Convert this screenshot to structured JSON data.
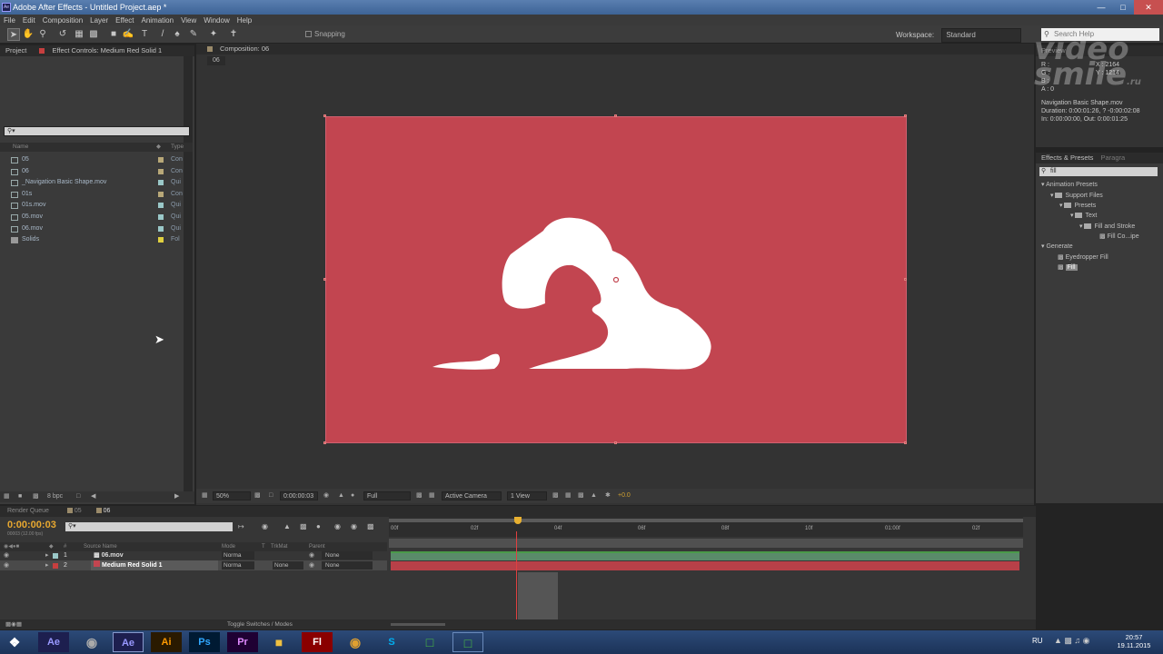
{
  "window": {
    "title": "Adobe After Effects - Untitled Project.aep *"
  },
  "menu": [
    "File",
    "Edit",
    "Composition",
    "Layer",
    "Effect",
    "Animation",
    "View",
    "Window",
    "Help"
  ],
  "toolbar": {
    "snapping": "Snapping",
    "workspace_label": "Workspace:",
    "workspace_value": "Standard",
    "search_placeholder": "Search Help"
  },
  "project_panel": {
    "tab_project": "Project",
    "tab_effect_controls": "Effect Controls: Medium Red Solid 1",
    "col_name": "Name",
    "col_type": "Type",
    "items": [
      {
        "name": "05",
        "type": "Con",
        "label_color": "#b8a878"
      },
      {
        "name": "06",
        "type": "Con",
        "label_color": "#b8a878"
      },
      {
        "name": "_Navigation Basic Shape.mov",
        "type": "Qui",
        "label_color": "#9ac8c8"
      },
      {
        "name": "01s",
        "type": "Con",
        "label_color": "#b8a878"
      },
      {
        "name": "01s.mov",
        "type": "Qui",
        "label_color": "#9ac8c8"
      },
      {
        "name": "05.mov",
        "type": "Qui",
        "label_color": "#9ac8c8"
      },
      {
        "name": "06.mov",
        "type": "Qui",
        "label_color": "#9ac8c8"
      },
      {
        "name": "Solids",
        "type": "Fol",
        "label_color": "#e0d040"
      }
    ],
    "bpc": "8 bpc"
  },
  "composition": {
    "tab": "Composition: 06",
    "breadcrumb": "06",
    "solid_color": "#c24550"
  },
  "viewer_controls": {
    "zoom": "50%",
    "timecode": "0:00:00:03",
    "resolution": "Full",
    "camera": "Active Camera",
    "views": "1 View",
    "exposure": "+0.0"
  },
  "info_panel": {
    "lines": [
      "Navigation Basic Shape.mov",
      "Duration: 0:00:01:26, ? -0:00:02:08",
      "In: 0:00:00:00, Out: 0:00:01:25"
    ],
    "r": "R :",
    "g": "G :",
    "b": "B :",
    "a": "A : 0",
    "x": "X : 2164",
    "y": "Y : 1214"
  },
  "effects_presets": {
    "tab_effects": "Effects & Presets",
    "tab_para": "Paragra",
    "search_value": "fill",
    "tree": [
      "Animation Presets",
      "Support Files",
      "Presets",
      "Text",
      "Fill and Stroke",
      "Fill Co...ipe",
      "Generate",
      "Eyedropper Fill",
      "Fill"
    ]
  },
  "timeline": {
    "tab_render": "Render Queue",
    "tab_05": "05",
    "tab_06": "06",
    "timecode": "0:00:00:03",
    "fps": "00003 (12.00 fps)",
    "col_source": "Source Name",
    "col_mode": "Mode",
    "col_t": "T",
    "col_trkmat": "TrkMat",
    "col_parent": "Parent",
    "ticks": [
      "00f",
      "02f",
      "04f",
      "06f",
      "08f",
      "10f",
      "01:00f",
      "02f"
    ],
    "layers": [
      {
        "num": "1",
        "name": "06.mov",
        "mode": "Norma",
        "trkmat": "",
        "parent": "None"
      },
      {
        "num": "2",
        "name": "Medium Red Solid 1",
        "mode": "Norma",
        "trkmat": "None",
        "parent": "None"
      }
    ],
    "toggle": "Toggle Switches / Modes"
  },
  "taskbar": {
    "lang": "RU",
    "time": "20:57",
    "date": "19.11.2015",
    "apps": [
      "Ae",
      "Ae",
      "Ai",
      "Ps",
      "Pr",
      "Fl",
      "S"
    ]
  },
  "watermark": {
    "line1": "video",
    "line2": "smile",
    "suffix": ".ru"
  }
}
